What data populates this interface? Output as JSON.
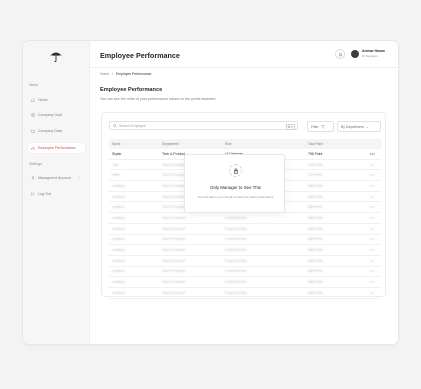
{
  "sidebar": {
    "menu_label": "Menu",
    "items": [
      {
        "label": "Home"
      },
      {
        "label": "Company Goal"
      },
      {
        "label": "Company Data"
      },
      {
        "label": "Employee Performance"
      }
    ],
    "settings_label": "Settings",
    "settings_items": [
      {
        "label": "Managment Account"
      },
      {
        "label": "Log Out"
      }
    ]
  },
  "header": {
    "title": "Employee Performance",
    "user_name": "Ammar Hasan",
    "user_role": "UI Designer"
  },
  "breadcrumb": {
    "home": "Home",
    "separator": "/",
    "current": "Employee Performance"
  },
  "section": {
    "title": "Employee Performance",
    "subtitle": "You can see the order of your performance based on the points awarded."
  },
  "toolbar": {
    "search_placeholder": "Search Employee",
    "search_shortcut": "⌘ K",
    "filter_label": "Filter",
    "department_label": "By Department"
  },
  "table": {
    "columns": [
      "Name",
      "Department",
      "Role",
      "Total Point",
      ""
    ],
    "rows": [
      {
        "name": "Skylar",
        "department": "Tech & Product",
        "role": "UI Designer",
        "points": "756 Point",
        "more": "•••",
        "blurred": false
      },
      {
        "name": "Loki",
        "department": "Tech & Product",
        "role": "UX Designer",
        "points": "740 Point",
        "more": "•••",
        "blurred": true
      },
      {
        "name": "Peter",
        "department": "Tech & Product",
        "role": "UX Researcher",
        "points": "720 Point",
        "more": "•••",
        "blurred": true
      },
      {
        "name": "Jamison",
        "department": "Tech & Product",
        "role": "Front End Dev",
        "points": "680 Point",
        "more": "•••",
        "blurred": true
      },
      {
        "name": "Jamison",
        "department": "Tech & Product",
        "role": "Front End Dev",
        "points": "680 Point",
        "more": "•••",
        "blurred": true
      },
      {
        "name": "Jamison",
        "department": "Tech & Product",
        "role": "Front End Dev",
        "points": "680 Point",
        "more": "•••",
        "blurred": true
      },
      {
        "name": "Jamison",
        "department": "Tech & Product",
        "role": "Front End Dev",
        "points": "680 Point",
        "more": "•••",
        "blurred": true
      },
      {
        "name": "Jamison",
        "department": "Tech & Product",
        "role": "Front End Dev",
        "points": "680 Point",
        "more": "•••",
        "blurred": true
      },
      {
        "name": "Jamison",
        "department": "Tech & Product",
        "role": "Front End Dev",
        "points": "680 Point",
        "more": "•••",
        "blurred": true
      },
      {
        "name": "Jamison",
        "department": "Tech & Product",
        "role": "Front End Dev",
        "points": "680 Point",
        "more": "•••",
        "blurred": true
      },
      {
        "name": "Jamison",
        "department": "Tech & Product",
        "role": "Front End Dev",
        "points": "680 Point",
        "more": "•••",
        "blurred": true
      },
      {
        "name": "Jamison",
        "department": "Tech & Product",
        "role": "Front End Dev",
        "points": "680 Point",
        "more": "•••",
        "blurred": true
      },
      {
        "name": "Jamison",
        "department": "Tech & Product",
        "role": "Front End Dev",
        "points": "680 Point",
        "more": "•••",
        "blurred": true
      },
      {
        "name": "Jamison",
        "department": "Tech & Product",
        "role": "Front End Dev",
        "points": "680 Point",
        "more": "•••",
        "blurred": true
      }
    ]
  },
  "lock_overlay": {
    "title": "Only Manager to See This",
    "subtitle": "You can ask to your friend to know the point performance"
  },
  "colors": {
    "accent": "#d9434b",
    "sidebar_bg": "#f6f6f7",
    "page_bg": "#f3f3f4"
  },
  "icons": {
    "logo": "umbrella-logo",
    "home": "home-icon",
    "goal": "target-icon",
    "data": "folder-icon",
    "performance": "chart-icon",
    "account": "user-icon",
    "logout": "logout-icon",
    "notification": "bell-icon",
    "search": "search-icon",
    "filter": "filter-icon",
    "lock": "lock-icon"
  }
}
